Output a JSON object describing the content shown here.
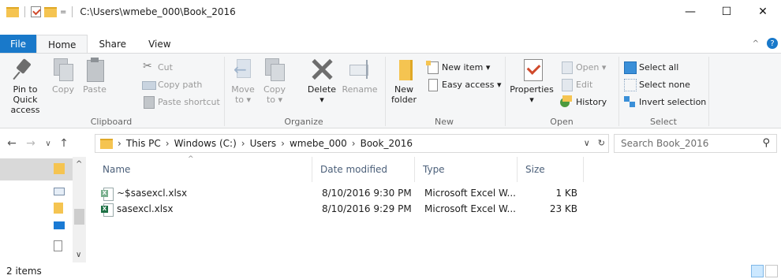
{
  "window": {
    "title": "C:\\Users\\wmebe_000\\Book_2016",
    "qat_dropdown": "=",
    "minimize": "—",
    "maximize": "☐",
    "close": "✕"
  },
  "tabs": [
    {
      "label": "File"
    },
    {
      "label": "Home"
    },
    {
      "label": "Share"
    },
    {
      "label": "View"
    }
  ],
  "ribbon": {
    "clipboard": {
      "label": "Clipboard",
      "pin": "Pin to Quick",
      "pin2": "access",
      "copy": "Copy",
      "paste": "Paste",
      "cut": "Cut",
      "copy_path": "Copy path",
      "paste_shortcut": "Paste shortcut"
    },
    "organize": {
      "label": "Organize",
      "move": "Move",
      "move2": "to ▾",
      "copy": "Copy",
      "copy2": "to ▾",
      "delete": "Delete",
      "delete2": "▾",
      "rename": "Rename"
    },
    "new": {
      "label": "New",
      "new_folder": "New",
      "new_folder2": "folder",
      "new_item": "New item ▾",
      "easy_access": "Easy access ▾"
    },
    "open": {
      "label": "Open",
      "properties": "Properties",
      "properties2": "▾",
      "open": "Open ▾",
      "edit": "Edit",
      "history": "History"
    },
    "select": {
      "label": "Select",
      "select_all": "Select all",
      "select_none": "Select none",
      "invert": "Invert selection"
    }
  },
  "address": {
    "crumbs": [
      "This PC",
      "Windows (C:)",
      "Users",
      "wmebe_000",
      "Book_2016"
    ],
    "search_placeholder": "Search Book_2016"
  },
  "columns": {
    "name": "Name",
    "date": "Date modified",
    "type": "Type",
    "size": "Size"
  },
  "files": [
    {
      "name": "~$sasexcl.xlsx",
      "date": "8/10/2016 9:30 PM",
      "type": "Microsoft Excel W...",
      "size": "1 KB"
    },
    {
      "name": "sasexcl.xlsx",
      "date": "8/10/2016 9:29 PM",
      "type": "Microsoft Excel W...",
      "size": "23 KB"
    }
  ],
  "status": {
    "items": "2 items"
  }
}
